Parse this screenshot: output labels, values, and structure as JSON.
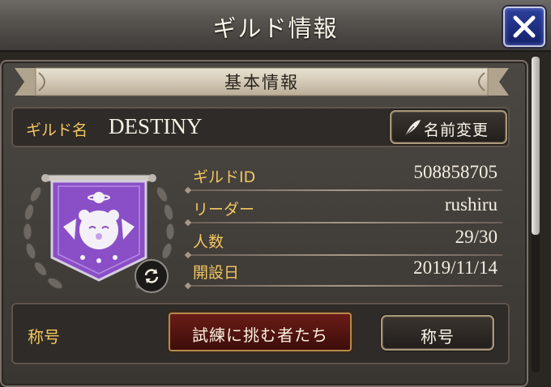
{
  "header": {
    "title": "ギルド情報",
    "close_icon": "close-icon"
  },
  "section": {
    "title": "基本情報"
  },
  "guild_name": {
    "label": "ギルド名",
    "value": "DESTINY",
    "rename_button": "名前変更",
    "rename_icon": "quill-pen-icon"
  },
  "info": [
    {
      "label": "ギルドID",
      "value": "508858705"
    },
    {
      "label": "リーダー",
      "value": "rushiru"
    },
    {
      "label": "人数",
      "value": "29/30"
    },
    {
      "label": "開設日",
      "value": "2019/11/14"
    }
  ],
  "emblem": {
    "icon": "moogle-banner-emblem",
    "banner_color": "#8a4fc6",
    "change_icon": "sync-icon"
  },
  "rank": {
    "label": "称号",
    "badge": "試練に挑む者たち",
    "button": "称号"
  },
  "colors": {
    "label_gold": "#f2c761",
    "close_blue": "#1f2f86",
    "badge_red": "#5a1712"
  }
}
